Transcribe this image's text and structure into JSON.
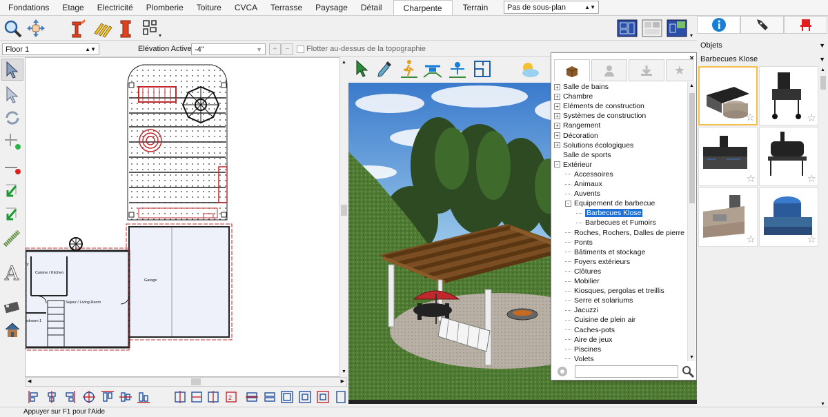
{
  "tabs": [
    "Fondations",
    "Etage",
    "Electricité",
    "Plomberie",
    "Toiture",
    "CVCA",
    "Terrasse",
    "Paysage",
    "Détail",
    "Charpente",
    "Terrain"
  ],
  "active_tab": "Charpente",
  "subplan_select": "Pas de sous-plan",
  "floor_select": "Floor 1",
  "elevation_label": "Elévation Active:",
  "elevation_value": "-4\"",
  "float_checkbox_label": "Flotter au-dessus de la topographie",
  "objects_select": "Objets",
  "category_select": "Barbecues Klose",
  "plan_labels": {
    "kitchen": "Cuisine / Kitchen",
    "living": "Sejour / Living Room",
    "garage": "Garage",
    "bedroom": "edroom 1",
    "pantry": "ry"
  },
  "tree": [
    {
      "label": "Salle de bains",
      "level": 0,
      "expander": "+"
    },
    {
      "label": "Chambre",
      "level": 0,
      "expander": "+"
    },
    {
      "label": "Eléments de construction",
      "level": 0,
      "expander": "+"
    },
    {
      "label": "Systèmes de construction",
      "level": 0,
      "expander": "+"
    },
    {
      "label": "Rangement",
      "level": 0,
      "expander": "+"
    },
    {
      "label": "Décoration",
      "level": 0,
      "expander": "+"
    },
    {
      "label": "Solutions écologiques",
      "level": 0,
      "expander": "+"
    },
    {
      "label": "Salle de sports",
      "level": 0,
      "expander": ""
    },
    {
      "label": "Extérieur",
      "level": 0,
      "expander": "-"
    },
    {
      "label": "Accessoires",
      "level": 1,
      "expander": ""
    },
    {
      "label": "Animaux",
      "level": 1,
      "expander": ""
    },
    {
      "label": "Auvents",
      "level": 1,
      "expander": ""
    },
    {
      "label": "Equipement de barbecue",
      "level": 1,
      "expander": "-"
    },
    {
      "label": "Barbecues Klose",
      "level": 2,
      "expander": "",
      "selected": true
    },
    {
      "label": "Barbecues et Fumoirs",
      "level": 2,
      "expander": ""
    },
    {
      "label": "Roches, Rochers, Dalles de pierre",
      "level": 1,
      "expander": ""
    },
    {
      "label": "Ponts",
      "level": 1,
      "expander": ""
    },
    {
      "label": "Bâtiments et stockage",
      "level": 1,
      "expander": ""
    },
    {
      "label": "Foyers extérieurs",
      "level": 1,
      "expander": ""
    },
    {
      "label": "Clôtures",
      "level": 1,
      "expander": ""
    },
    {
      "label": "Mobilier",
      "level": 1,
      "expander": ""
    },
    {
      "label": "Kiosques, pergolas et treillis",
      "level": 1,
      "expander": ""
    },
    {
      "label": "Serre et solariums",
      "level": 1,
      "expander": ""
    },
    {
      "label": "Jacuzzi",
      "level": 1,
      "expander": ""
    },
    {
      "label": "Cuisine de plein air",
      "level": 1,
      "expander": ""
    },
    {
      "label": "Caches-pots",
      "level": 1,
      "expander": ""
    },
    {
      "label": "Aire de jeux",
      "level": 1,
      "expander": ""
    },
    {
      "label": "Piscines",
      "level": 1,
      "expander": ""
    },
    {
      "label": "Volets",
      "level": 1,
      "expander": ""
    }
  ],
  "library_search": "",
  "status_text": "Appuyer sur F1 pour l'Aide",
  "colors": {
    "accent": "#1e6fd9",
    "info_blue": "#1a7fd4",
    "arrow_red": "#e0421e",
    "wall_red": "#c0282d"
  }
}
